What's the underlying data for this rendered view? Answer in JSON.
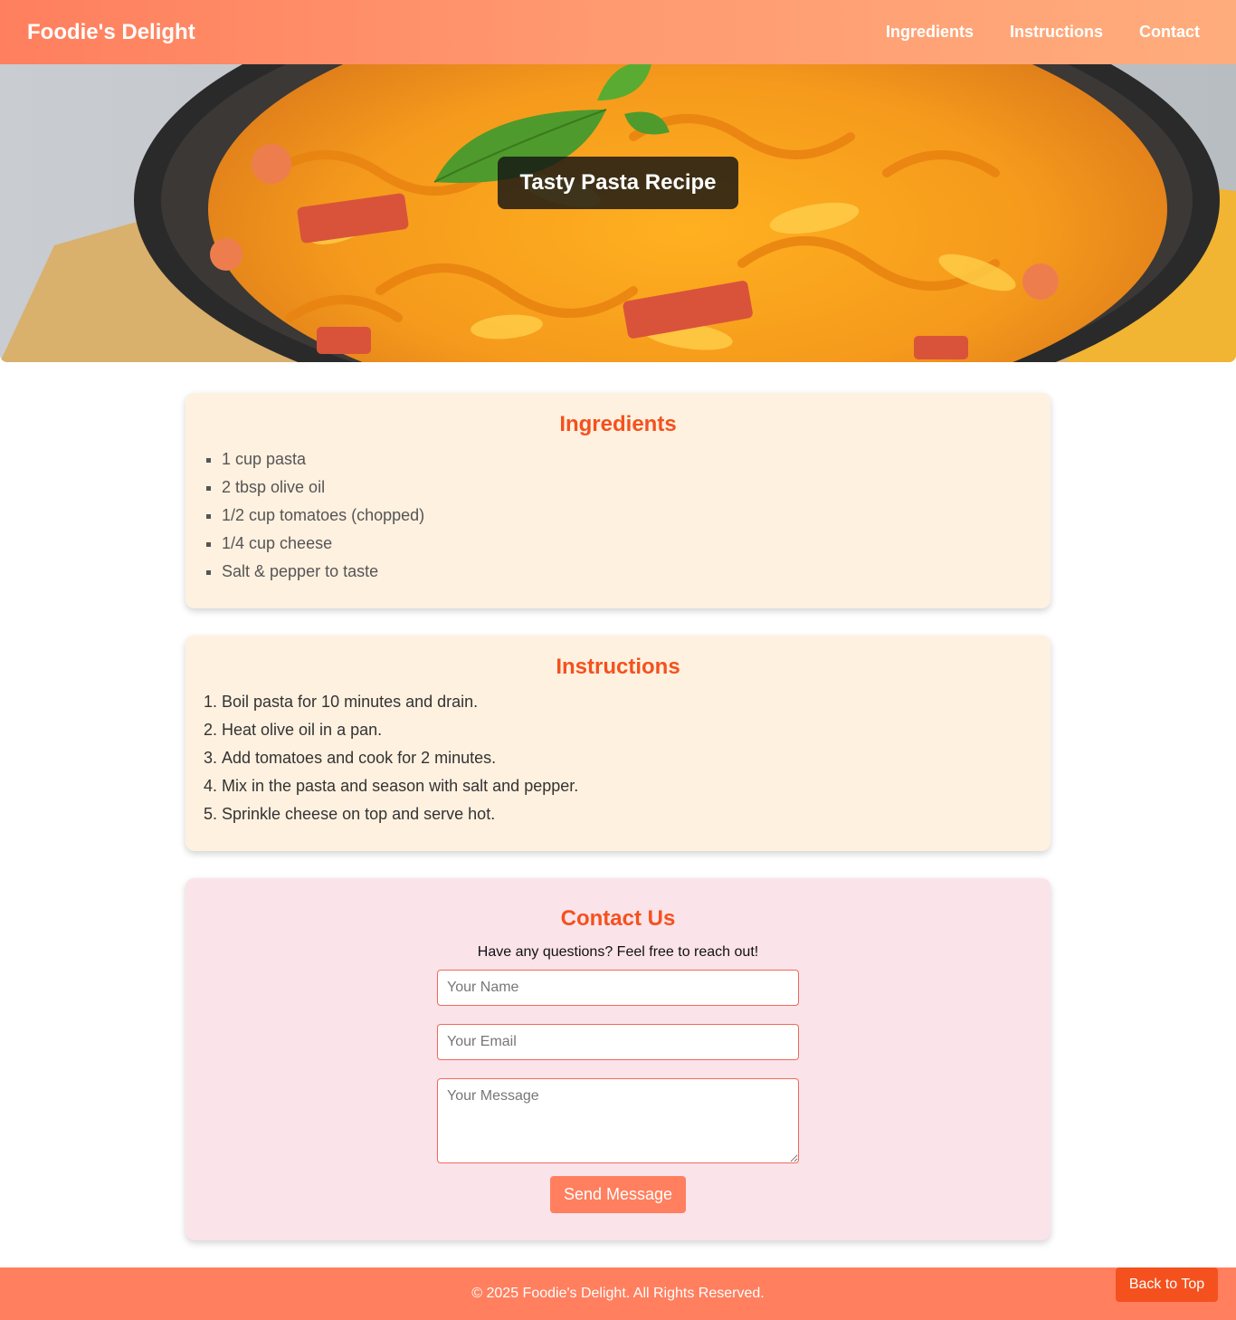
{
  "navbar": {
    "brand": "Foodie's Delight",
    "links": [
      "Ingredients",
      "Instructions",
      "Contact"
    ]
  },
  "hero": {
    "title": "Tasty Pasta Recipe",
    "image": "pasta-dish-photo"
  },
  "ingredients": {
    "heading": "Ingredients",
    "items": [
      "1 cup pasta",
      "2 tbsp olive oil",
      "1/2 cup tomatoes (chopped)",
      "1/4 cup cheese",
      "Salt & pepper to taste"
    ]
  },
  "instructions": {
    "heading": "Instructions",
    "steps": [
      "Boil pasta for 10 minutes and drain.",
      "Heat olive oil in a pan.",
      "Add tomatoes and cook for 2 minutes.",
      "Mix in the pasta and season with salt and pepper.",
      "Sprinkle cheese on top and serve hot."
    ]
  },
  "contact": {
    "heading": "Contact Us",
    "subtitle": "Have any questions? Feel free to reach out!",
    "name_placeholder": "Your Name",
    "email_placeholder": "Your Email",
    "message_placeholder": "Your Message",
    "send_label": "Send Message"
  },
  "footer": {
    "copyright": "© 2025 Foodie's Delight. All Rights Reserved.",
    "back_to_top": "Back to Top"
  },
  "colors": {
    "accent": "#ff7f5e",
    "heading": "#f4511e",
    "card_bg": "#fff1e0",
    "contact_bg": "#fbe3ea"
  }
}
